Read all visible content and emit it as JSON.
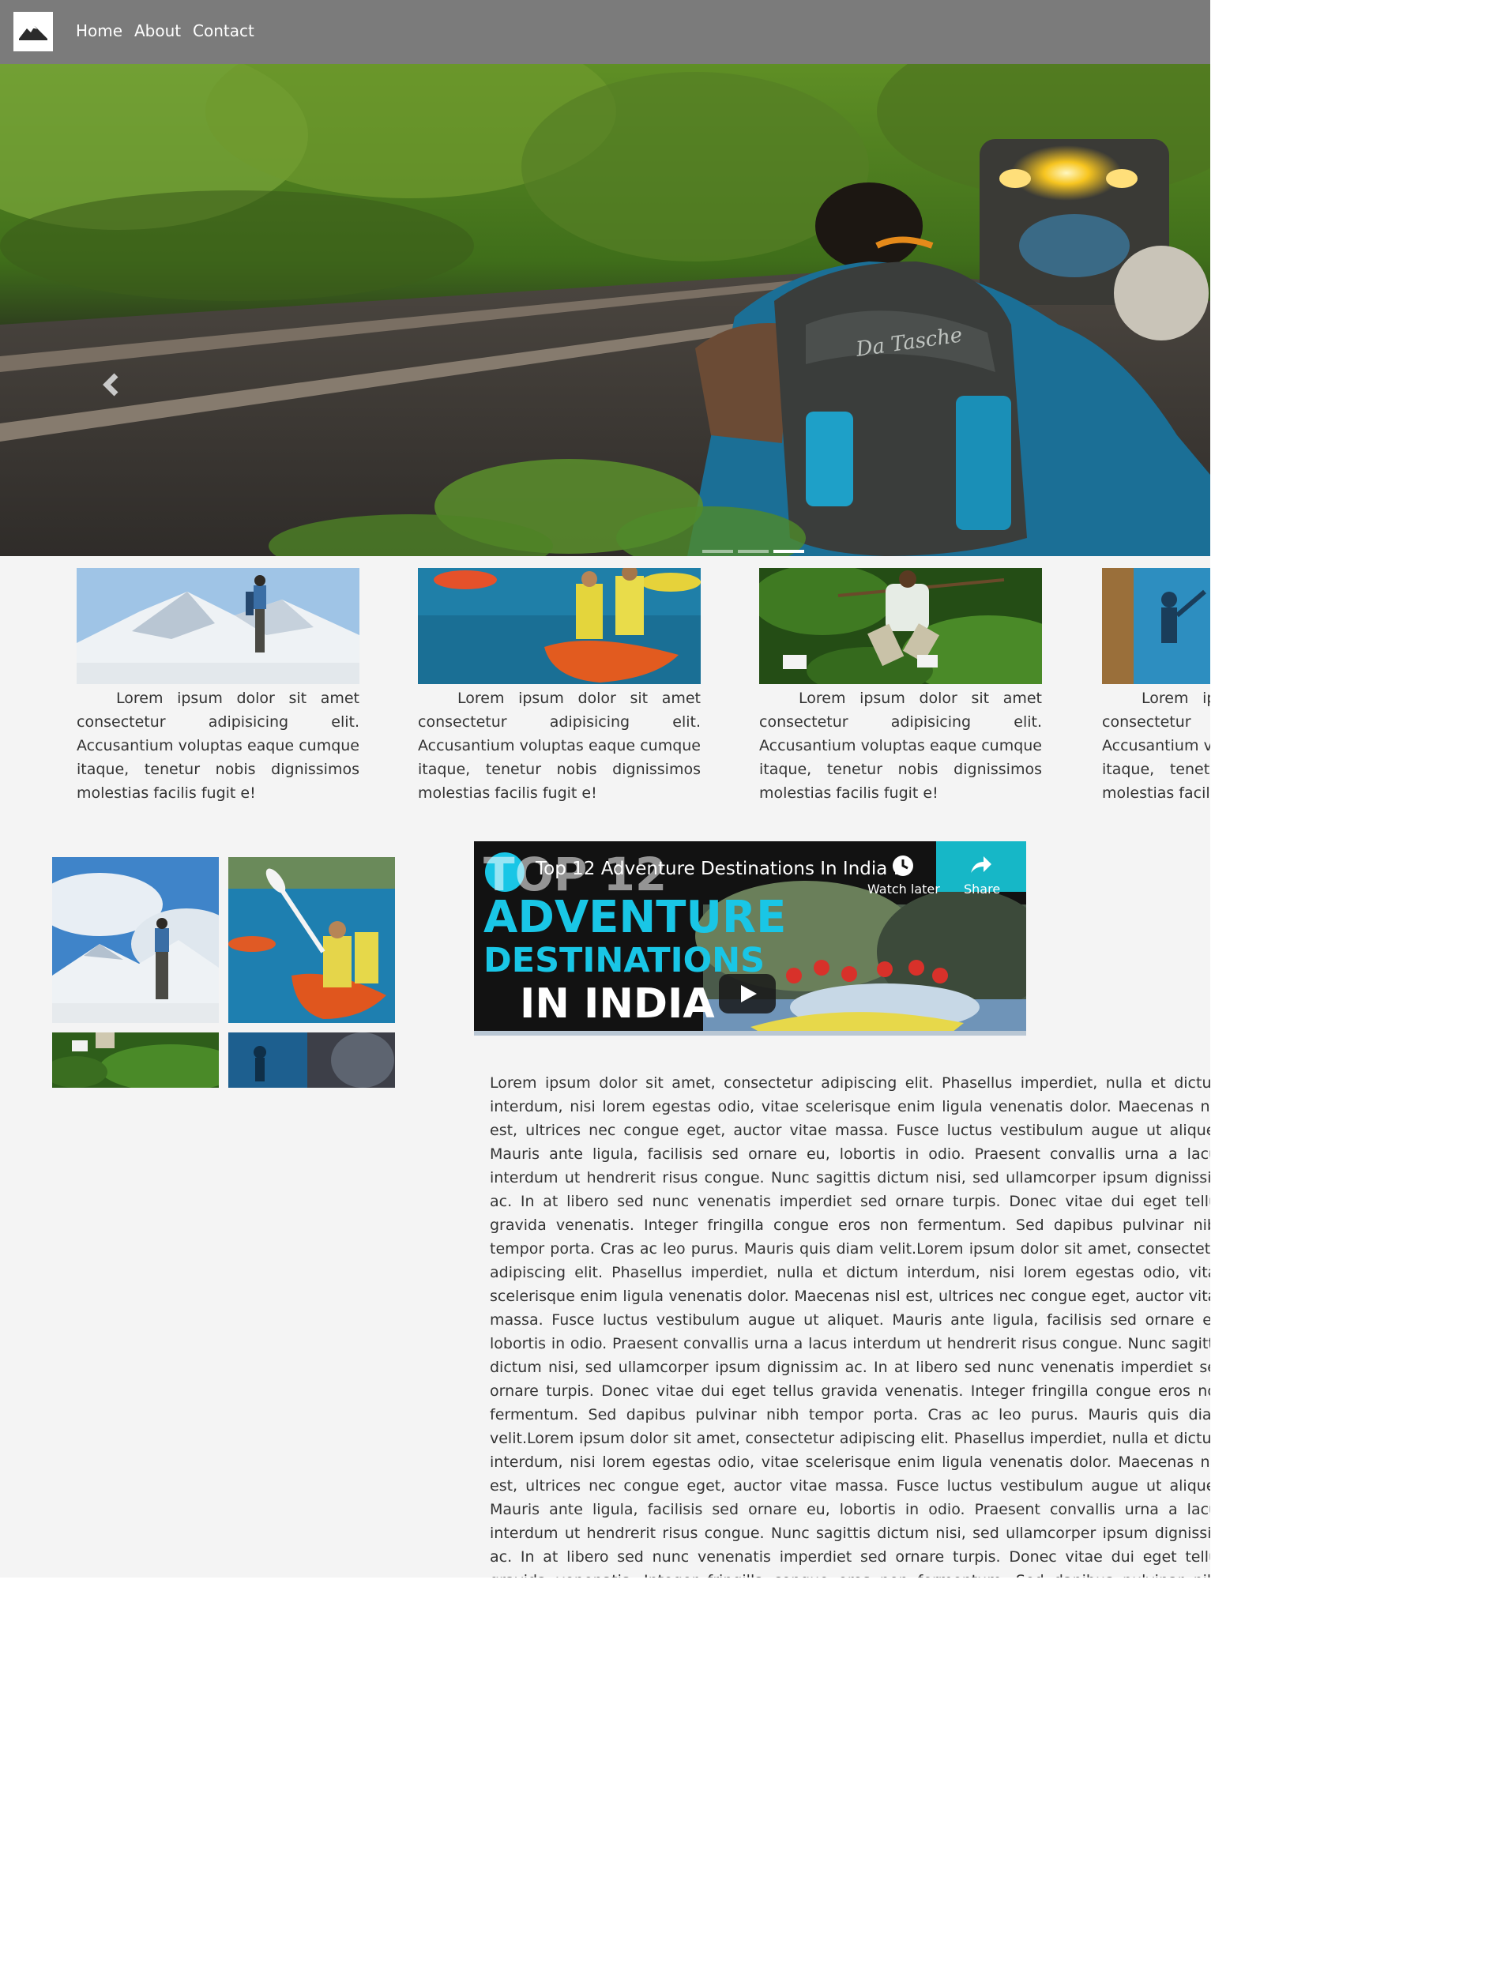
{
  "nav": {
    "logo_alt": "logo",
    "links": [
      "Home",
      "About",
      "Contact"
    ]
  },
  "hero": {
    "slides": 3,
    "active_slide": 3,
    "backpack_text": "Da Tasche"
  },
  "cards": [
    {
      "text": "Lorem ipsum dolor sit amet consectetur adipisicing elit. Accusantium voluptas eaque cumque itaque, tenetur nobis dignissimos molestias facilis fugit e!"
    },
    {
      "text": "Lorem ipsum dolor sit amet consectetur adipisicing elit. Accusantium voluptas eaque cumque itaque, tenetur nobis dignissimos molestias facilis fugit e!"
    },
    {
      "text": "Lorem ipsum dolor sit amet consectetur adipisicing elit. Accusantium voluptas eaque cumque itaque, tenetur nobis dignissimos molestias facilis fugit e!"
    },
    {
      "text": "Lorem ipsum dolor sit amet consectetur adipisicing elit. Accusantium voluptas eaque cumque itaque, tenetur nobis dignissimos molestias facilis fugit e!"
    }
  ],
  "video": {
    "title": "Top 12 Adventure Destinations In India ...",
    "thumb_line1": "TOP 12",
    "thumb_line2": "ADVENTURE",
    "thumb_line3": "DESTINATIONS",
    "thumb_line4": "IN INDIA",
    "watch_later": "Watch later",
    "share": "Share"
  },
  "article": {
    "text": "Lorem ipsum dolor sit amet, consectetur adipiscing elit. Phasellus imperdiet, nulla et dictum interdum, nisi lorem egestas odio, vitae scelerisque enim ligula venenatis dolor. Maecenas nisl est, ultrices nec congue eget, auctor vitae massa. Fusce luctus vestibulum augue ut aliquet. Mauris ante ligula, facilisis sed ornare eu, lobortis in odio. Praesent convallis urna a lacus interdum ut hendrerit risus congue. Nunc sagittis dictum nisi, sed ullamcorper ipsum dignissim ac. In at libero sed nunc venenatis imperdiet sed ornare turpis. Donec vitae dui eget tellus gravida venenatis. Integer fringilla congue eros non fermentum. Sed dapibus pulvinar nibh tempor porta. Cras ac leo purus. Mauris quis diam velit.Lorem ipsum dolor sit amet, consectetur adipiscing elit. Phasellus imperdiet, nulla et dictum interdum, nisi lorem egestas odio, vitae scelerisque enim ligula venenatis dolor. Maecenas nisl est, ultrices nec congue eget, auctor vitae massa. Fusce luctus vestibulum augue ut aliquet. Mauris ante ligula, facilisis sed ornare eu, lobortis in odio. Praesent convallis urna a lacus interdum ut hendrerit risus congue. Nunc sagittis dictum nisi, sed ullamcorper ipsum dignissim ac. In at libero sed nunc venenatis imperdiet sed ornare turpis. Donec vitae dui eget tellus gravida venenatis. Integer fringilla congue eros non fermentum. Sed dapibus pulvinar nibh tempor porta. Cras ac leo purus. Mauris quis diam velit.Lorem ipsum dolor sit amet, consectetur adipiscing elit. Phasellus imperdiet, nulla et dictum interdum, nisi lorem egestas odio, vitae scelerisque enim ligula venenatis dolor. Maecenas nisl est, ultrices nec congue eget, auctor vitae massa. Fusce luctus vestibulum augue ut aliquet. Mauris ante ligula, facilisis sed ornare eu, lobortis in odio. Praesent convallis urna a lacus interdum ut hendrerit risus congue. Nunc sagittis dictum nisi, sed ullamcorper ipsum dignissim ac. In at libero sed nunc venenatis imperdiet sed ornare turpis. Donec vitae dui eget tellus gravida venenatis. Integer fringilla congue eros non fermentum. Sed dapibus pulvinar nibh tempor porta. Cras ac leo purus. Mauris quis diam velit.Lorem ipsum dolor sit amet, consectetur adipiscing elit. Phasellus imperdiet, nulla et dictum interdum, nisi lorem egestas odio, vitae scelerisque enim ligula venenatis dolor. Maecenas nisl est, ultrices nec congue eget, auctor vitae massa. Fusce luctus vestibulum augue ut aliquet. Mauris ante ligula, facilisis sed ornare eu, lobortis in odio. Praesent convallis urna a lacus interdum ut hendrerit risus congue. Nunc sagittis dictum nisi, sed ullamcorper"
  }
}
